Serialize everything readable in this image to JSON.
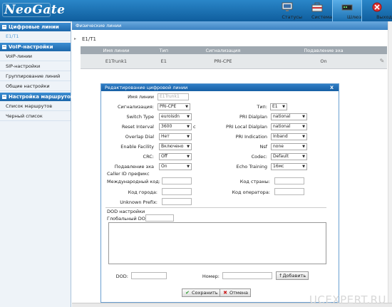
{
  "header": {
    "logo": "NeoGate",
    "nav": [
      {
        "label": "Статусы",
        "icon": "monitor-icon"
      },
      {
        "label": "Система",
        "icon": "toolbox-icon"
      },
      {
        "label": "Шлюз",
        "icon": "gateway-icon"
      },
      {
        "label": "Выход",
        "icon": "exit-icon"
      }
    ]
  },
  "sidebar": {
    "sections": [
      {
        "title": "Цифровые линии",
        "items": [
          "E1/T1"
        ]
      },
      {
        "title": "VoIP-настройки",
        "items": [
          "VoIP-линии",
          "SIP-настройки",
          "Группирование линий",
          "Общие настройки"
        ]
      },
      {
        "title": "Настройка маршрутов",
        "items": [
          "Список маршрутов",
          "Черный список"
        ]
      }
    ]
  },
  "main": {
    "breadcrumb": "Физические линии",
    "subsection": "E1/T1",
    "table": {
      "columns": [
        "Имя линии",
        "Тип",
        "Сигнализация",
        "Подавление эха"
      ],
      "rows": [
        [
          "E1Trunk1",
          "E1",
          "PRI-CPE",
          "On"
        ]
      ]
    }
  },
  "modal": {
    "title": "Редактирование цифровой линии",
    "close": "X",
    "fields": {
      "line_name_label": "Имя линии",
      "line_name_value": "E1Trunk1",
      "signaling_label": "Сигнализация:",
      "signaling_value": "PRI-CPE",
      "type_label": "Тип:",
      "type_value": "E1",
      "switch_type_label": "Switch Type",
      "switch_type_value": "euroisdn",
      "pri_dialplan_label": "PRI Dialplan",
      "pri_dialplan_value": "national",
      "reset_interval_label": "Reset Interval",
      "reset_interval_value": "3600",
      "reset_interval_unit": "c",
      "pri_local_dialplan_label": "PRI Local Dialplan",
      "pri_local_dialplan_value": "national",
      "overlap_dial_label": "Overlap Dial",
      "overlap_dial_value": "Нет",
      "pri_indication_label": "PRI Indication",
      "pri_indication_value": "Inband",
      "enable_facility_label": "Enable Facility",
      "enable_facility_value": "Включено",
      "nsf_label": "Nsf",
      "nsf_value": "none",
      "crc_label": "CRC:",
      "crc_value": "Off",
      "codec_label": "Codec:",
      "codec_value": "Default",
      "echo_label": "Подавление эха",
      "echo_value": "On",
      "echo_training_label": "Echo Training",
      "echo_training_value": "16мс"
    },
    "callerid": {
      "title": "Caller ID префикс",
      "international_label": "Международный код:",
      "country_label": "Код страны:",
      "city_label": "Код города:",
      "operator_label": "Код оператора:",
      "unknown_label": "Unknown Prefix:"
    },
    "dod": {
      "title": "DOD настройки",
      "global_label": "Глобальный DOD:",
      "dod_label": "DOD:",
      "number_label": "Номер:",
      "add_button": "↑Добавить"
    },
    "save_button": "Сохранить",
    "cancel_button": "Отмена"
  },
  "watermark": "UCEXPERT.RU"
}
